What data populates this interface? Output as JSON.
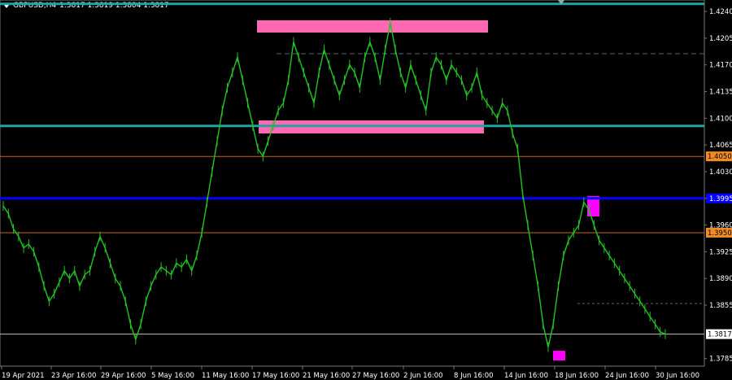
{
  "header": {
    "symbol_tf": "GBPUSD,H4",
    "ohlc": "1.3817 1.3819 1.3804 1.3817"
  },
  "chart_data": {
    "type": "line",
    "y_tick_labels": [
      "1.4240",
      "1.4205",
      "1.4170",
      "1.4135",
      "1.4100",
      "1.4065",
      "1.4030",
      "1.3995",
      "1.3960",
      "1.3925",
      "1.3890",
      "1.3855",
      "1.3820",
      "1.3785"
    ],
    "x_tick_labels": [
      "19 Apr 2021",
      "23 Apr 16:00",
      "29 Apr 16:00",
      "5 May 16:00",
      "11 May 16:00",
      "17 May 16:00",
      "21 May 16:00",
      "27 May 16:00",
      "2 Jun 16:00",
      "8 Jun 16:00",
      "14 Jun 16:00",
      "18 Jun 16:00",
      "24 Jun 16:00",
      "30 Jun 16:00"
    ],
    "ylim": [
      1.3775,
      1.4255
    ],
    "series": [
      {
        "color": "#22c322",
        "values": [
          1.3985,
          1.3975,
          1.3955,
          1.3945,
          1.393,
          1.3935,
          1.3925,
          1.3905,
          1.388,
          1.386,
          1.387,
          1.3885,
          1.39,
          1.389,
          1.39,
          1.388,
          1.3895,
          1.39,
          1.3925,
          1.3945,
          1.393,
          1.391,
          1.389,
          1.388,
          1.386,
          1.383,
          1.381,
          1.383,
          1.386,
          1.388,
          1.3895,
          1.3905,
          1.39,
          1.3895,
          1.391,
          1.3905,
          1.3915,
          1.39,
          1.392,
          1.395,
          1.399,
          1.403,
          1.407,
          1.411,
          1.414,
          1.416,
          1.418,
          1.415,
          1.412,
          1.409,
          1.406,
          1.405,
          1.407,
          1.409,
          1.411,
          1.412,
          1.415,
          1.42,
          1.418,
          1.416,
          1.414,
          1.412,
          1.416,
          1.419,
          1.417,
          1.415,
          1.413,
          1.415,
          1.417,
          1.416,
          1.414,
          1.418,
          1.42,
          1.418,
          1.415,
          1.419,
          1.4225,
          1.419,
          1.416,
          1.414,
          1.417,
          1.415,
          1.413,
          1.411,
          1.416,
          1.418,
          1.417,
          1.415,
          1.417,
          1.416,
          1.415,
          1.413,
          1.414,
          1.416,
          1.413,
          1.412,
          1.411,
          1.41,
          1.412,
          1.411,
          1.408,
          1.406,
          1.4,
          1.396,
          1.392,
          1.388,
          1.383,
          1.38,
          1.383,
          1.388,
          1.392,
          1.394,
          1.395,
          1.396,
          1.399,
          1.398,
          1.396,
          1.394,
          1.393,
          1.392,
          1.391,
          1.39,
          1.389,
          1.388,
          1.387,
          1.386,
          1.385,
          1.384,
          1.383,
          1.382,
          1.3817
        ]
      }
    ],
    "levels": [
      {
        "value": 1.425,
        "label": "",
        "color": "#1fa3a3"
      },
      {
        "value": 1.409,
        "label": "",
        "color": "#1fa3a3"
      },
      {
        "value": 1.405,
        "label": "1.4050",
        "color": "#c8641a"
      },
      {
        "value": 1.3995,
        "label": "",
        "color": "#0000ff"
      },
      {
        "value": 1.395,
        "label": "1.3950",
        "color": "#c8641a"
      },
      {
        "value": 1.3817,
        "label": "1.3817",
        "color": "#bfbfbf"
      }
    ],
    "grid": false,
    "current_price_label": "1.3817"
  }
}
